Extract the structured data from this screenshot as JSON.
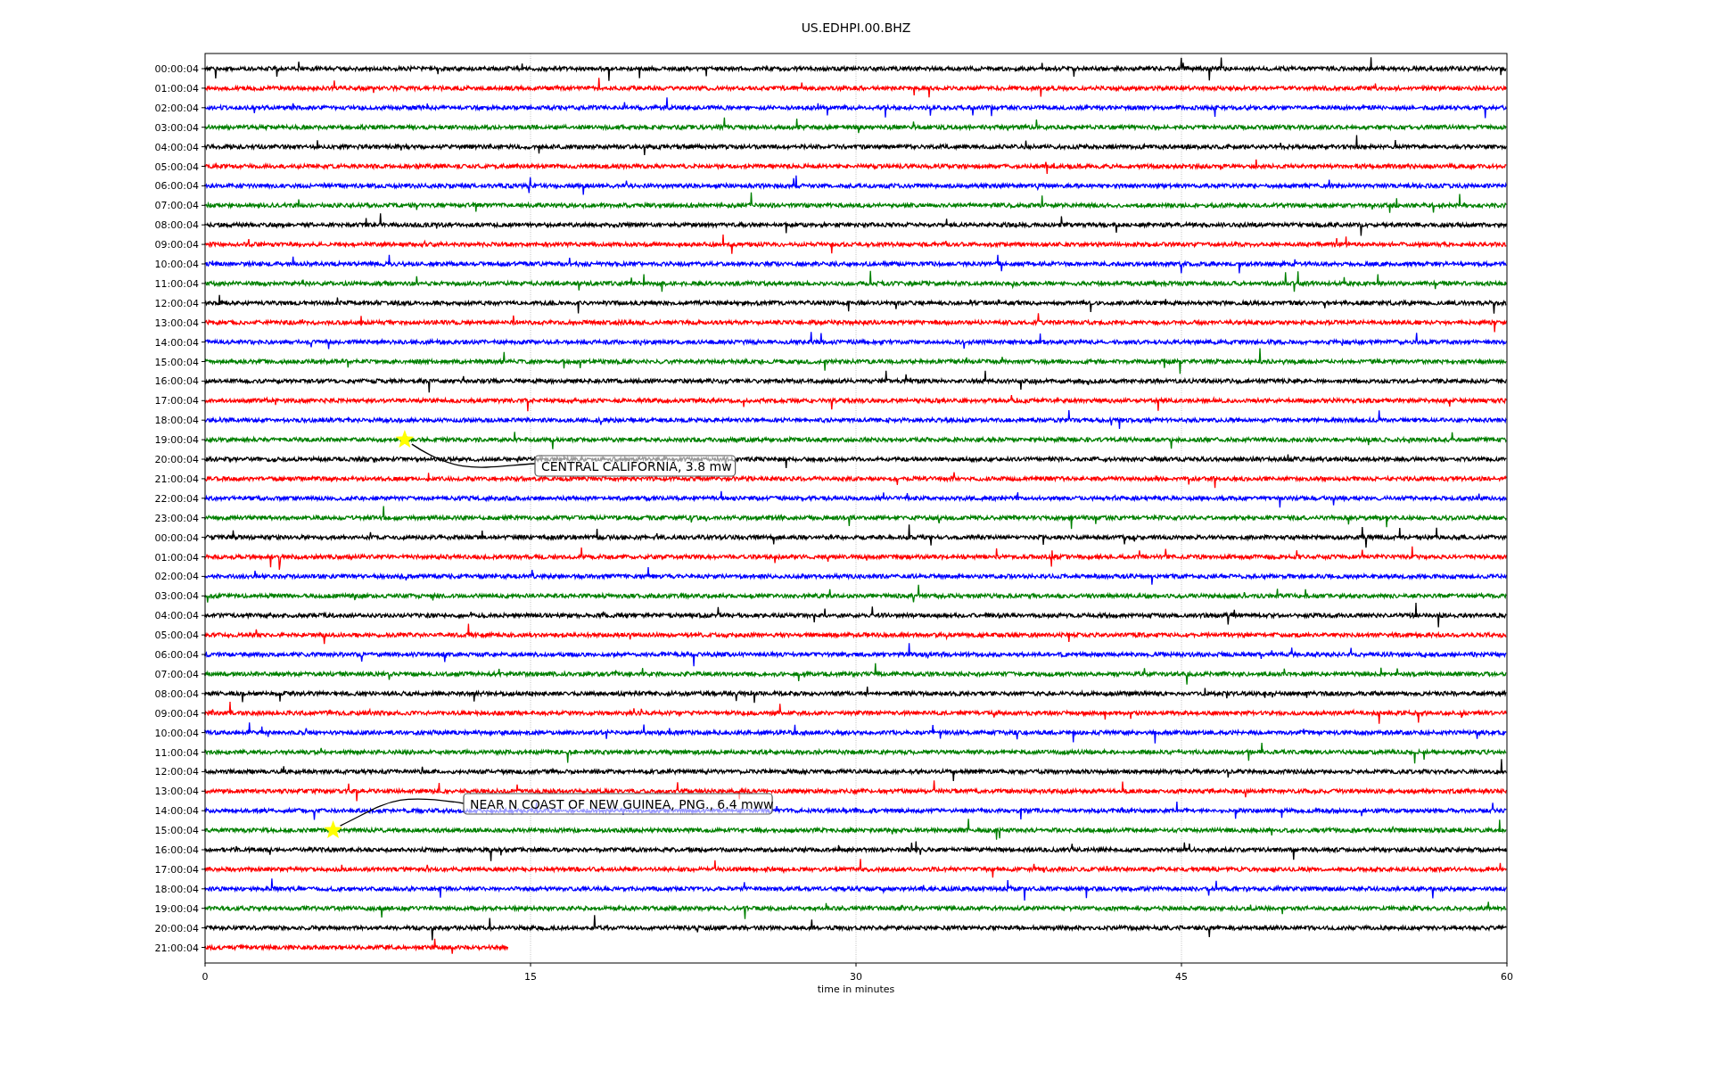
{
  "title": "US.EDHPI.00.BHZ",
  "x_axis": {
    "label": "time in minutes",
    "ticks": [
      "0",
      "15",
      "30",
      "45",
      "60"
    ]
  },
  "rows": [
    {
      "label": "00:00:04",
      "color": "#000000"
    },
    {
      "label": "01:00:04",
      "color": "#ff0000"
    },
    {
      "label": "02:00:04",
      "color": "#0000ff"
    },
    {
      "label": "03:00:04",
      "color": "#008000"
    },
    {
      "label": "04:00:04",
      "color": "#000000"
    },
    {
      "label": "05:00:04",
      "color": "#ff0000"
    },
    {
      "label": "06:00:04",
      "color": "#0000ff"
    },
    {
      "label": "07:00:04",
      "color": "#008000"
    },
    {
      "label": "08:00:04",
      "color": "#000000"
    },
    {
      "label": "09:00:04",
      "color": "#ff0000"
    },
    {
      "label": "10:00:04",
      "color": "#0000ff"
    },
    {
      "label": "11:00:04",
      "color": "#008000"
    },
    {
      "label": "12:00:04",
      "color": "#000000"
    },
    {
      "label": "13:00:04",
      "color": "#ff0000"
    },
    {
      "label": "14:00:04",
      "color": "#0000ff"
    },
    {
      "label": "15:00:04",
      "color": "#008000"
    },
    {
      "label": "16:00:04",
      "color": "#000000"
    },
    {
      "label": "17:00:04",
      "color": "#ff0000"
    },
    {
      "label": "18:00:04",
      "color": "#0000ff"
    },
    {
      "label": "19:00:04",
      "color": "#008000"
    },
    {
      "label": "20:00:04",
      "color": "#000000"
    },
    {
      "label": "21:00:04",
      "color": "#ff0000"
    },
    {
      "label": "22:00:04",
      "color": "#0000ff"
    },
    {
      "label": "23:00:04",
      "color": "#008000"
    },
    {
      "label": "00:00:04",
      "color": "#000000"
    },
    {
      "label": "01:00:04",
      "color": "#ff0000"
    },
    {
      "label": "02:00:04",
      "color": "#0000ff"
    },
    {
      "label": "03:00:04",
      "color": "#008000"
    },
    {
      "label": "04:00:04",
      "color": "#000000"
    },
    {
      "label": "05:00:04",
      "color": "#ff0000"
    },
    {
      "label": "06:00:04",
      "color": "#0000ff"
    },
    {
      "label": "07:00:04",
      "color": "#008000"
    },
    {
      "label": "08:00:04",
      "color": "#000000"
    },
    {
      "label": "09:00:04",
      "color": "#ff0000"
    },
    {
      "label": "10:00:04",
      "color": "#0000ff"
    },
    {
      "label": "11:00:04",
      "color": "#008000"
    },
    {
      "label": "12:00:04",
      "color": "#000000"
    },
    {
      "label": "13:00:04",
      "color": "#ff0000"
    },
    {
      "label": "14:00:04",
      "color": "#0000ff"
    },
    {
      "label": "15:00:04",
      "color": "#008000"
    },
    {
      "label": "16:00:04",
      "color": "#000000"
    },
    {
      "label": "17:00:04",
      "color": "#ff0000"
    },
    {
      "label": "18:00:04",
      "color": "#0000ff"
    },
    {
      "label": "19:00:04",
      "color": "#008000"
    },
    {
      "label": "20:00:04",
      "color": "#000000"
    },
    {
      "label": "21:00:04",
      "color": "#ff0000",
      "level": 0.233
    }
  ],
  "events": [
    {
      "label": "CENTRAL CALIFORNIA, 3.8 mw"
    },
    {
      "label": "NEAR N COAST OF NEW GUINEA, PNG., 6.4 mww"
    }
  ]
}
